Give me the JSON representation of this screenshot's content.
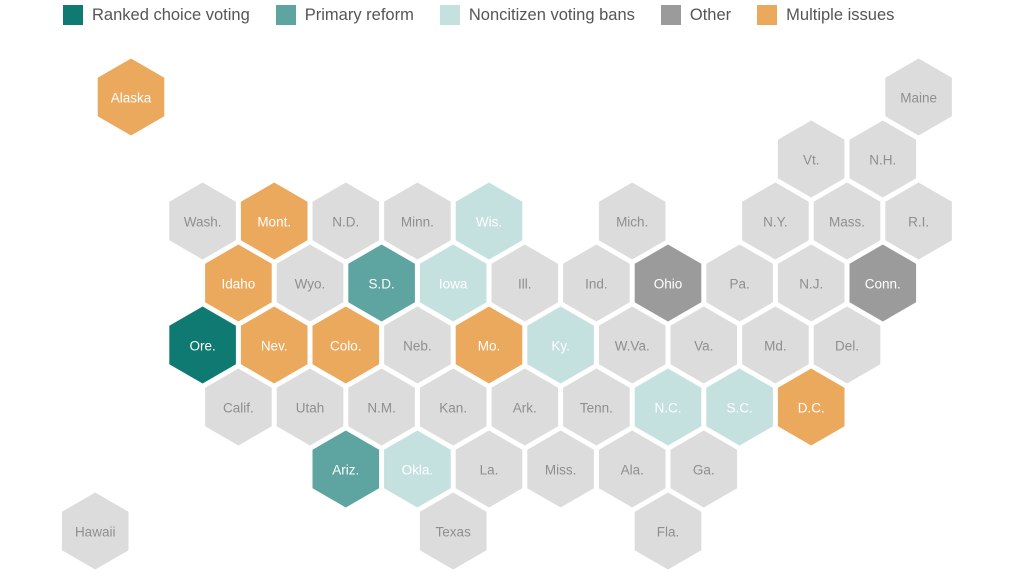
{
  "legend": [
    {
      "key": "rcv",
      "label": "Ranked choice voting",
      "color": "#0f7a72"
    },
    {
      "key": "primary",
      "label": "Primary reform",
      "color": "#5ea4a1"
    },
    {
      "key": "noncitizen",
      "label": "Noncitizen voting bans",
      "color": "#c4e0df"
    },
    {
      "key": "other",
      "label": "Other",
      "color": "#9b9b9b"
    },
    {
      "key": "multiple",
      "label": "Multiple issues",
      "color": "#eaa95c"
    }
  ],
  "default_fill": "#dcdcdc",
  "label_colors": {
    "dark": "#8f8f8f",
    "light": "#ffffff"
  },
  "states": [
    {
      "label": "Alaska",
      "category": "multiple",
      "col": 0,
      "row": 0
    },
    {
      "label": "Maine",
      "category": null,
      "col": 11,
      "row": 0
    },
    {
      "label": "Vt.",
      "category": null,
      "col": 9.5,
      "row": 1
    },
    {
      "label": "N.H.",
      "category": null,
      "col": 10.5,
      "row": 1
    },
    {
      "label": "Wash.",
      "category": null,
      "col": 1,
      "row": 2
    },
    {
      "label": "Mont.",
      "category": "multiple",
      "col": 2,
      "row": 2
    },
    {
      "label": "N.D.",
      "category": null,
      "col": 3,
      "row": 2
    },
    {
      "label": "Minn.",
      "category": null,
      "col": 4,
      "row": 2
    },
    {
      "label": "Wis.",
      "category": "noncitizen",
      "col": 5,
      "row": 2
    },
    {
      "label": "Mich.",
      "category": null,
      "col": 7,
      "row": 2
    },
    {
      "label": "N.Y.",
      "category": null,
      "col": 9,
      "row": 2
    },
    {
      "label": "Mass.",
      "category": null,
      "col": 10,
      "row": 2
    },
    {
      "label": "R.I.",
      "category": null,
      "col": 11,
      "row": 2
    },
    {
      "label": "Idaho",
      "category": "multiple",
      "col": 1.5,
      "row": 3
    },
    {
      "label": "Wyo.",
      "category": null,
      "col": 2.5,
      "row": 3
    },
    {
      "label": "S.D.",
      "category": "primary",
      "col": 3.5,
      "row": 3
    },
    {
      "label": "Iowa",
      "category": "noncitizen",
      "col": 4.5,
      "row": 3
    },
    {
      "label": "Ill.",
      "category": null,
      "col": 5.5,
      "row": 3
    },
    {
      "label": "Ind.",
      "category": null,
      "col": 6.5,
      "row": 3
    },
    {
      "label": "Ohio",
      "category": "other",
      "col": 7.5,
      "row": 3
    },
    {
      "label": "Pa.",
      "category": null,
      "col": 8.5,
      "row": 3
    },
    {
      "label": "N.J.",
      "category": null,
      "col": 9.5,
      "row": 3
    },
    {
      "label": "Conn.",
      "category": "other",
      "col": 10.5,
      "row": 3
    },
    {
      "label": "Ore.",
      "category": "rcv",
      "col": 1,
      "row": 4
    },
    {
      "label": "Nev.",
      "category": "multiple",
      "col": 2,
      "row": 4
    },
    {
      "label": "Colo.",
      "category": "multiple",
      "col": 3,
      "row": 4
    },
    {
      "label": "Neb.",
      "category": null,
      "col": 4,
      "row": 4
    },
    {
      "label": "Mo.",
      "category": "multiple",
      "col": 5,
      "row": 4
    },
    {
      "label": "Ky.",
      "category": "noncitizen",
      "col": 6,
      "row": 4
    },
    {
      "label": "W.Va.",
      "category": null,
      "col": 7,
      "row": 4
    },
    {
      "label": "Va.",
      "category": null,
      "col": 8,
      "row": 4
    },
    {
      "label": "Md.",
      "category": null,
      "col": 9,
      "row": 4
    },
    {
      "label": "Del.",
      "category": null,
      "col": 10,
      "row": 4
    },
    {
      "label": "Calif.",
      "category": null,
      "col": 1.5,
      "row": 5
    },
    {
      "label": "Utah",
      "category": null,
      "col": 2.5,
      "row": 5
    },
    {
      "label": "N.M.",
      "category": null,
      "col": 3.5,
      "row": 5
    },
    {
      "label": "Kan.",
      "category": null,
      "col": 4.5,
      "row": 5
    },
    {
      "label": "Ark.",
      "category": null,
      "col": 5.5,
      "row": 5
    },
    {
      "label": "Tenn.",
      "category": null,
      "col": 6.5,
      "row": 5
    },
    {
      "label": "N.C.",
      "category": "noncitizen",
      "col": 7.5,
      "row": 5
    },
    {
      "label": "S.C.",
      "category": "noncitizen",
      "col": 8.5,
      "row": 5
    },
    {
      "label": "D.C.",
      "category": "multiple",
      "col": 9.5,
      "row": 5
    },
    {
      "label": "Ariz.",
      "category": "primary",
      "col": 3,
      "row": 6
    },
    {
      "label": "Okla.",
      "category": "noncitizen",
      "col": 4,
      "row": 6
    },
    {
      "label": "La.",
      "category": null,
      "col": 5,
      "row": 6
    },
    {
      "label": "Miss.",
      "category": null,
      "col": 6,
      "row": 6
    },
    {
      "label": "Ala.",
      "category": null,
      "col": 7,
      "row": 6
    },
    {
      "label": "Ga.",
      "category": null,
      "col": 8,
      "row": 6
    },
    {
      "label": "Hawaii",
      "category": null,
      "col": -0.5,
      "row": 7
    },
    {
      "label": "Texas",
      "category": null,
      "col": 4.5,
      "row": 7
    },
    {
      "label": "Fla.",
      "category": null,
      "col": 7.5,
      "row": 7
    }
  ]
}
